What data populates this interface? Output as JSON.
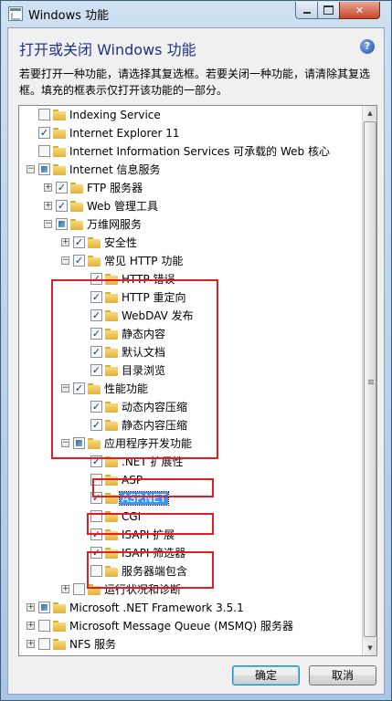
{
  "window": {
    "title": "Windows 功能"
  },
  "caption_buttons": {
    "minimize": "–",
    "maximize": "□",
    "close": "✕"
  },
  "header": {
    "heading": "打开或关闭 Windows 功能",
    "help_icon": "?",
    "description": "若要打开一种功能，请选择其复选框。若要关闭一种功能，请清除其复选框。填充的框表示仅打开该功能的一部分。"
  },
  "tree": {
    "items": [
      {
        "label": "Indexing Service",
        "level": 0,
        "expander": "",
        "state": "unchecked"
      },
      {
        "label": "Internet Explorer 11",
        "level": 0,
        "expander": "",
        "state": "checked"
      },
      {
        "label": "Internet Information Services 可承载的 Web 核心",
        "level": 0,
        "expander": "",
        "state": "unchecked"
      },
      {
        "label": "Internet 信息服务",
        "level": 0,
        "expander": "−",
        "state": "partial"
      },
      {
        "label": "FTP 服务器",
        "level": 1,
        "expander": "+",
        "state": "checked"
      },
      {
        "label": "Web 管理工具",
        "level": 1,
        "expander": "+",
        "state": "checked"
      },
      {
        "label": "万维网服务",
        "level": 1,
        "expander": "−",
        "state": "partial"
      },
      {
        "label": "安全性",
        "level": 2,
        "expander": "+",
        "state": "checked"
      },
      {
        "label": "常见 HTTP 功能",
        "level": 2,
        "expander": "−",
        "state": "checked"
      },
      {
        "label": "HTTP 错误",
        "level": 3,
        "expander": "",
        "state": "checked"
      },
      {
        "label": "HTTP 重定向",
        "level": 3,
        "expander": "",
        "state": "checked"
      },
      {
        "label": "WebDAV 发布",
        "level": 3,
        "expander": "",
        "state": "checked"
      },
      {
        "label": "静态内容",
        "level": 3,
        "expander": "",
        "state": "checked"
      },
      {
        "label": "默认文档",
        "level": 3,
        "expander": "",
        "state": "checked"
      },
      {
        "label": "目录浏览",
        "level": 3,
        "expander": "",
        "state": "checked"
      },
      {
        "label": "性能功能",
        "level": 2,
        "expander": "−",
        "state": "checked"
      },
      {
        "label": "动态内容压缩",
        "level": 3,
        "expander": "",
        "state": "checked"
      },
      {
        "label": "静态内容压缩",
        "level": 3,
        "expander": "",
        "state": "checked"
      },
      {
        "label": "应用程序开发功能",
        "level": 2,
        "expander": "−",
        "state": "partial"
      },
      {
        "label": ".NET 扩展性",
        "level": 3,
        "expander": "",
        "state": "checked"
      },
      {
        "label": "ASP",
        "level": 3,
        "expander": "",
        "state": "unchecked"
      },
      {
        "label": "ASP.NET",
        "level": 3,
        "expander": "",
        "state": "checked",
        "selected": true
      },
      {
        "label": "CGI",
        "level": 3,
        "expander": "",
        "state": "unchecked"
      },
      {
        "label": "ISAPI 扩展",
        "level": 3,
        "expander": "",
        "state": "checked"
      },
      {
        "label": "ISAPI 筛选器",
        "level": 3,
        "expander": "",
        "state": "checked"
      },
      {
        "label": "服务器端包含",
        "level": 3,
        "expander": "",
        "state": "unchecked"
      },
      {
        "label": "运行状况和诊断",
        "level": 2,
        "expander": "+",
        "state": "unchecked"
      },
      {
        "label": "Microsoft .NET Framework 3.5.1",
        "level": 0,
        "expander": "+",
        "state": "partial"
      },
      {
        "label": "Microsoft Message Queue (MSMQ) 服务器",
        "level": 0,
        "expander": "+",
        "state": "unchecked"
      },
      {
        "label": "NFS 服务",
        "level": 0,
        "expander": "+",
        "state": "unchecked"
      }
    ]
  },
  "scrollbar": {
    "up_arrow": "▲",
    "down_arrow": "▼"
  },
  "buttons": {
    "ok": "确定",
    "cancel": "取消"
  },
  "colors": {
    "highlight_box": "#e21d25",
    "selection": "#3399ff",
    "heading": "#1e3287"
  }
}
